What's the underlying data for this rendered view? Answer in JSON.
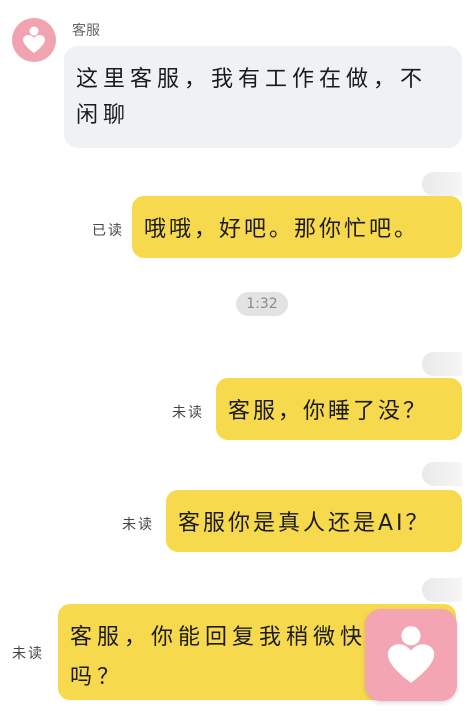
{
  "colors": {
    "background": "#ffffff",
    "incoming_bubble": "#eef2f4",
    "outgoing_bubble": "#f6d94c",
    "brand_pink": "#f2a3b2",
    "timestamp_bg": "#e3e3e3"
  },
  "messages": [
    {
      "direction": "incoming",
      "sender": "客服",
      "text": "这里客服，我有工作在做，不闲聊"
    },
    {
      "direction": "outgoing",
      "status": "已读",
      "text": "哦哦，好吧。那你忙吧。"
    },
    {
      "type": "timestamp",
      "text": "1:32"
    },
    {
      "direction": "outgoing",
      "status": "未读",
      "text": "客服，你睡了没？"
    },
    {
      "direction": "outgoing",
      "status": "未读",
      "text": "客服你是真人还是AI？"
    },
    {
      "direction": "outgoing",
      "status": "未读",
      "text": "客服，你能回复我稍微快一点吗？"
    }
  ],
  "icons": {
    "avatar": "heart-logo-icon",
    "floating_app": "heart-logo-icon"
  }
}
